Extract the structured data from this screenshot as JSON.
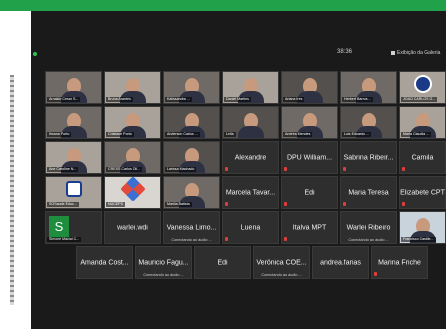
{
  "zoom": {
    "time": "38:36",
    "view_label": "Exibição da Galeria"
  },
  "grid": {
    "row1": [
      {
        "label": "Arnaldo Cesar S..."
      },
      {
        "label": "Bruna Arantes"
      },
      {
        "label": "Kalissandra ..."
      },
      {
        "label": "Daniel Martins"
      },
      {
        "label": "Ariana Ires"
      },
      {
        "label": "Herbert Barros..."
      },
      {
        "label": "JOAO CARLOS G..."
      }
    ],
    "row2": [
      {
        "label": "Ihsana Porto"
      },
      {
        "label": "Cristiane Porto"
      },
      {
        "label": "Anderson Carlos ..."
      },
      {
        "label": "Leila"
      },
      {
        "label": "Andréa Mendes"
      },
      {
        "label": "Luis Eduardo ..."
      },
      {
        "label": "Maria Claudia ..."
      }
    ],
    "row3": [
      {
        "label": "Ane Caroline N..."
      },
      {
        "label": "CRESS Carlos Oli..."
      },
      {
        "label": "Larissa Machado"
      },
      {
        "name": "Alexandre"
      },
      {
        "name": "DPU William..."
      },
      {
        "name": "Sabrina Ribeir..."
      },
      {
        "name": "Camila"
      }
    ],
    "row4": [
      {
        "label": "SOSaúde Educ..."
      },
      {
        "label": "NUCEPS"
      },
      {
        "label": "Marilia Batista"
      },
      {
        "name": "Marcela Tavar..."
      },
      {
        "name": "Edi"
      },
      {
        "name": "Maria Teresa"
      },
      {
        "name": "Elizabete CPT"
      }
    ],
    "row5": [
      {
        "label": "Simone Macial C...",
        "avatar": "S"
      },
      {
        "name": "warlei.wdi"
      },
      {
        "name": "Vanessa Limo...",
        "status": "Conectando ao áudio ..."
      },
      {
        "name": "Luena"
      },
      {
        "name": "Italva MPT"
      },
      {
        "name": "Warlei Ribeiro",
        "status": "Conectando ao áudio ..."
      },
      {
        "label": "Francisco Castile..."
      }
    ],
    "row6": [
      {
        "name": "Amanda Cost..."
      },
      {
        "name": "Mauricio Fagu...",
        "status": "Conectando ao áudio ..."
      },
      {
        "name": "Edi"
      },
      {
        "name": "Verônica COE...",
        "status": "Conectando ao áudio ..."
      },
      {
        "name": "andrea.farias"
      },
      {
        "name": "Marina Friche"
      }
    ]
  },
  "colors": {
    "top_bar": "#21a24a",
    "tile_bg": "#2e2e2e",
    "muted_mic": "#e03c3c"
  }
}
